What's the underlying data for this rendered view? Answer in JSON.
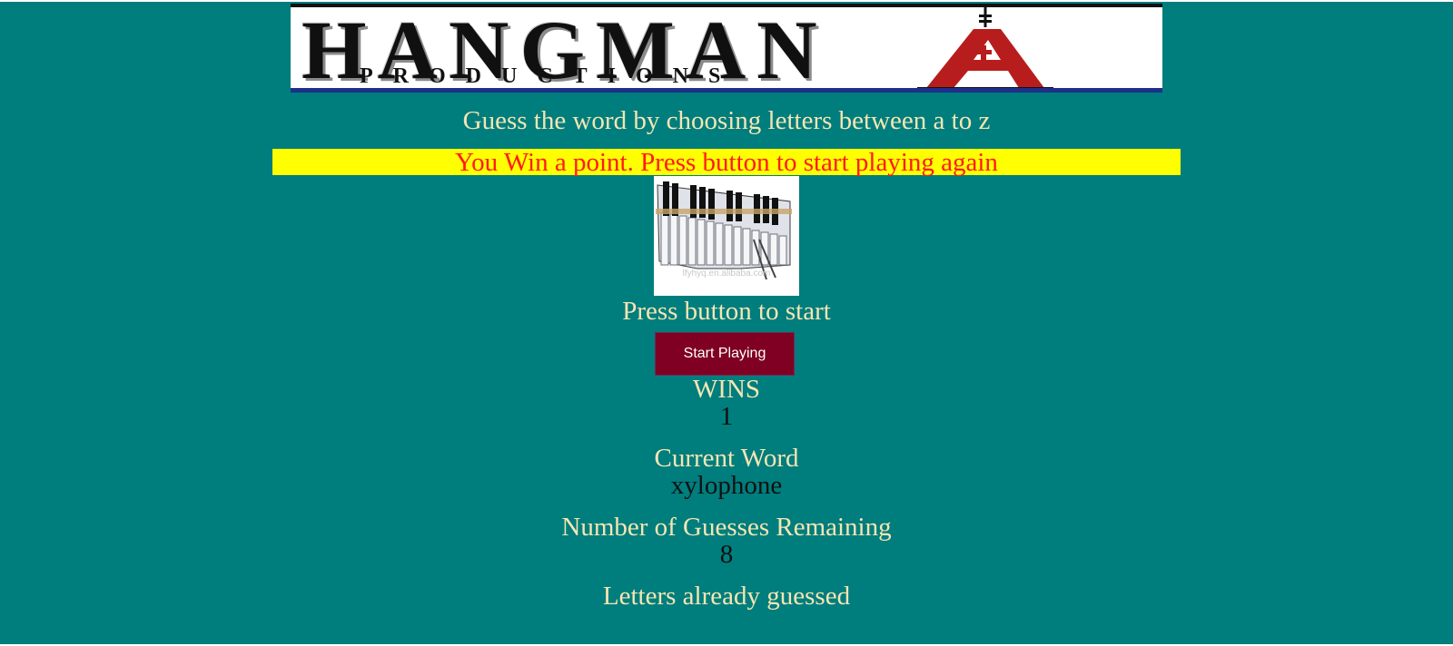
{
  "logo": {
    "title": "HANGMAN",
    "subtitle": "PRODUCTIONS"
  },
  "instruction": "Guess the word by choosing letters between a to z",
  "status_banner": "You Win a point. Press button to start playing again",
  "hint_image": {
    "watermark": "lfyhyq.en.alibaba.com"
  },
  "prompt": "Press button to start",
  "start_button": "Start Playing",
  "stats": {
    "wins_label": "WINS",
    "wins_value": "1",
    "word_label": "Current Word",
    "word_value": "xylophone",
    "guesses_label": "Number of Guesses Remaining",
    "guesses_value": "8",
    "letters_label": "Letters already guessed",
    "letters_value": ""
  },
  "colors": {
    "background": "#007d7d",
    "banner_bg": "#ffff00",
    "banner_text": "#ff1a1a",
    "button_bg": "#7f0022",
    "label_text": "#f5e6b3"
  }
}
